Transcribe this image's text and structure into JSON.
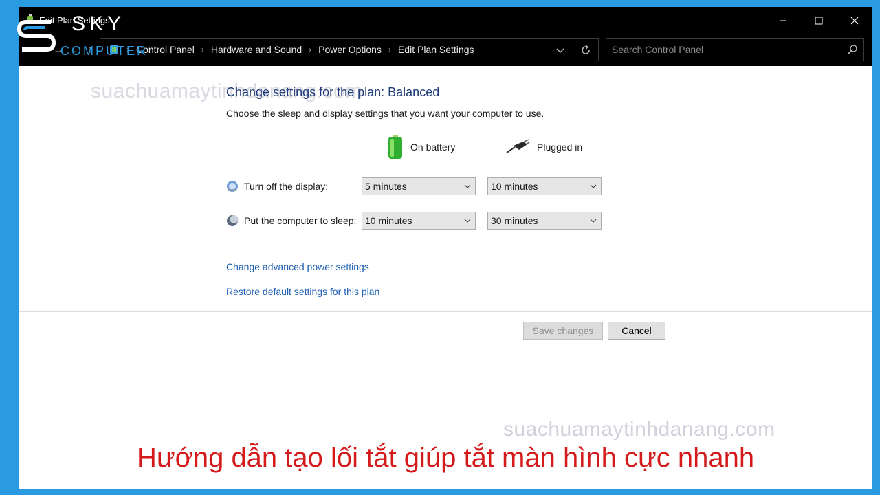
{
  "window": {
    "title": "Edit Plan Settings"
  },
  "address": {
    "breadcrumbs": [
      "Control Panel",
      "Hardware and Sound",
      "Power Options",
      "Edit Plan Settings"
    ]
  },
  "search": {
    "placeholder": "Search Control Panel"
  },
  "main": {
    "heading": "Change settings for the plan: Balanced",
    "subheading": "Choose the sleep and display settings that you want your computer to use.",
    "columns": {
      "battery": "On battery",
      "plugged": "Plugged in"
    },
    "rows": [
      {
        "label": "Turn off the display:",
        "battery": "5 minutes",
        "plugged": "10 minutes"
      },
      {
        "label": "Put the computer to sleep:",
        "battery": "10 minutes",
        "plugged": "30 minutes"
      }
    ],
    "links": {
      "advanced": "Change advanced power settings",
      "restore": "Restore default settings for this plan"
    },
    "buttons": {
      "save": "Save changes",
      "cancel": "Cancel"
    }
  },
  "overlay": {
    "logo_sky": "SKY",
    "logo_computer": "COMPUTER",
    "watermark": "suachuamaytinhdanang.com",
    "caption": "Hướng dẫn tạo lối tắt giúp tắt màn hình cực nhanh"
  },
  "colors": {
    "frame": "#2a9be0",
    "heading": "#1e3a78",
    "link": "#1e5fb4",
    "caption": "#d41a1a"
  }
}
